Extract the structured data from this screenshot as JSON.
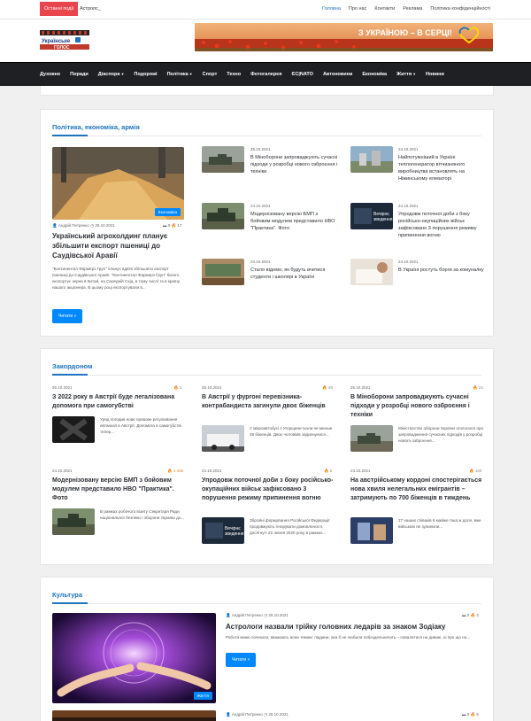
{
  "topbar": {
    "breaking_label": "Останні події",
    "ticker": "Астролс_",
    "links": [
      "Головна",
      "Про нас",
      "Контакти",
      "Реклама",
      "Політика конфіденційності"
    ]
  },
  "header": {
    "logo_text": "Українське голос",
    "banner_text": "З УКРАЇНОЮ – В СЕРЦІ!"
  },
  "nav": {
    "items": [
      "Духовне",
      "Поради",
      "Діаспора",
      "Подорожі",
      "Політика",
      "Спорт",
      "Техно",
      "Фотогалерея",
      "ЄС|NATO",
      "Автоновини",
      "Економіка",
      "Життя",
      "Новини"
    ]
  },
  "politics": {
    "title": "Політика, економіка, армія",
    "main": {
      "category": "Економіка",
      "author": "Андрій Петренко",
      "date": "25.10.2021",
      "comments": "0",
      "views": "17",
      "title": "Український агрохолдинг планує збільшити експорт пшениці до Саудівської Аравії",
      "excerpt": "\"Континентал Фармерз Груп\" планує вдвічі збільшити експорт пшениці до Саудівської Аравії. \"Континентал Фармерз Груп\" багато експортує зерна в Китай, на Середній Схід, в тому числі та в країну нашого акціонера. В цьому році експортували в...",
      "read_more": "Читати »"
    },
    "col2": [
      {
        "date": "25.10.2021",
        "title": "В Міноборони запроваджують сучасні підходи у розробці нового озброєння і техніки"
      },
      {
        "date": "24.10.2021",
        "title": "Модернізовану версію БМП з бойовим модулем представило НВО \"Практика\". Фото"
      },
      {
        "date": "23.10.2021",
        "title": "Стало відомо, як будуть вчитися студенти і школярі в Україні"
      }
    ],
    "col3": [
      {
        "date": "24.10.2021",
        "title": "Найпотужніший в Україні теплогенератор вітчизняного виробництва встановлять на Ніжинському елеваторі"
      },
      {
        "date": "24.10.2021",
        "title": "Упродовж поточної доби з боку російсько-окупаційних військ зафіксовано 3 порушення режиму припинення вогню"
      },
      {
        "date": "24.10.2021",
        "title": "В Україні ростуть борги за комуналку"
      }
    ]
  },
  "abroad": {
    "title": "Закордоном",
    "items": [
      {
        "date": "25.10.2021",
        "views": "1",
        "title": "З 2022 року в Австрії буде легалізована допомога при самогубстві",
        "excerpt": "Уряд погодив нове правове регулювання евтаназії в Австрії. Допомога в самогубстві тепер..."
      },
      {
        "date": "25.10.2021",
        "views": "49",
        "title": "В Австрії у фургоні перевізника-контрабандиста загинули двоє біженців",
        "excerpt": "У мікроавтобусі з Угорщини їхали не менше 28 біженців. Двоє чоловіків задихнулися..."
      },
      {
        "date": "25.10.2021",
        "views": "24",
        "title": "В Міноборони запроваджують сучасні підходи у розробці нового озброєння і техніки",
        "excerpt": "Міністерство оборони України оголосило про запровадження сучасних підходів у розробці нового озброєння..."
      },
      {
        "date": "24.10.2021",
        "views": "1 426",
        "title": "Модернізовану версію БМП з бойовим модулем представило НВО \"Практика\". Фото",
        "excerpt": "В рамках робочого візиту Секретаря Ради національної безпеки і оборони України до..."
      },
      {
        "date": "24.10.2021",
        "views": "5",
        "title": "Упродовж поточної доби з боку російсько-окупаційних військ зафіксовано 3 порушення режиму припинення вогню",
        "excerpt": "Збройні формування Російської Федерації продовжують ігнорувати домовленості, досягнуті 22 липня 2020 року в рамках..."
      },
      {
        "date": "24.10.2021",
        "views": "160",
        "title": "На австрійському кордоні спостерігається нова хвиля нелегальних емігрантів – затримують по 700 біженців в тиждень",
        "excerpt": "27 наших співаків 6 майже така ж доля, вже військові не зупинили..."
      }
    ]
  },
  "culture": {
    "title": "Культура",
    "main": {
      "category": "Життя",
      "author": "Андрій Петренко",
      "date": "25.10.2021",
      "comments": "0",
      "views": "2",
      "title": "Астрологи назвали трійку головних ледарів за знаком Зодіаку",
      "excerpt": "Робота може почекати, вважають вони темам: людини, яка б не любила побездельничать – повалятися на дивані, ні про що не...",
      "read_more": "Читати »"
    },
    "next": {
      "author": "Андрій Петренко",
      "date": "25.10.2021",
      "comments": "0",
      "views": "5"
    }
  }
}
